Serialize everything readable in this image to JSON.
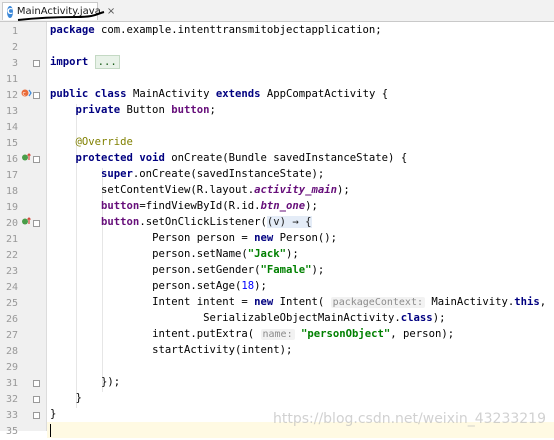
{
  "tab": {
    "icon": "class-file-icon",
    "icon_letter": "C",
    "title": "MainActivity.java",
    "close": "×"
  },
  "watermark": "https://blog.csdn.net/weixin_43233219",
  "colors": {
    "keyword": "#000080",
    "string": "#008000",
    "annotation": "#808000",
    "field": "#660e7a",
    "number": "#0000ff",
    "hint": "#8c8c8c",
    "current_line": "#fffae3"
  },
  "lines": [
    {
      "num": "1",
      "text": "package com.example.intenttransmitobjectapplication;"
    },
    {
      "num": "2",
      "text": ""
    },
    {
      "num": "3",
      "text": "import ..."
    },
    {
      "num": "11",
      "text": ""
    },
    {
      "num": "12",
      "text": "public class MainActivity extends AppCompatActivity {"
    },
    {
      "num": "13",
      "text": "    private Button button;"
    },
    {
      "num": "14",
      "text": ""
    },
    {
      "num": "15",
      "text": "    @Override"
    },
    {
      "num": "16",
      "text": "    protected void onCreate(Bundle savedInstanceState) {"
    },
    {
      "num": "17",
      "text": "        super.onCreate(savedInstanceState);"
    },
    {
      "num": "18",
      "text": "        setContentView(R.layout.activity_main);"
    },
    {
      "num": "19",
      "text": "        button=findViewById(R.id.btn_one);"
    },
    {
      "num": "20",
      "text": "        button.setOnClickListener((v) → {"
    },
    {
      "num": "21",
      "text": "                Person person = new Person();"
    },
    {
      "num": "22",
      "text": "                person.setName(\"Jack\");"
    },
    {
      "num": "23",
      "text": "                person.setGender(\"Famale\");"
    },
    {
      "num": "24",
      "text": "                person.setAge(18);"
    },
    {
      "num": "25",
      "text": "                Intent intent = new Intent( packageContext: MainActivity.this,"
    },
    {
      "num": "26",
      "text": "                        SerializableObjectMainActivity.class);"
    },
    {
      "num": "27",
      "text": "                intent.putExtra( name: \"personObject\", person);"
    },
    {
      "num": "28",
      "text": "                startActivity(intent);"
    },
    {
      "num": "29",
      "text": ""
    },
    {
      "num": "31",
      "text": "        });"
    },
    {
      "num": "32",
      "text": "    }"
    },
    {
      "num": "33",
      "text": "}"
    },
    {
      "num": "35",
      "text": ""
    }
  ],
  "tokens": {
    "package_kw": "package",
    "package_name": " com.example.intenttransmitobjectapplication;",
    "import_kw": "import",
    "import_fold": "...",
    "public": "public",
    "class": "class",
    "extends": "extends",
    "class_name": " MainActivity ",
    "super_name": " AppCompatActivity {",
    "private": "private",
    "button_type": " Button ",
    "button_field": "button",
    "semicolon": ";",
    "override": "@Override",
    "protected": "protected",
    "void": "void",
    "oncreate_sig": " onCreate(Bundle savedInstanceState) {",
    "super_kw": "super",
    "super_call": ".onCreate(savedInstanceState);",
    "setcontent_a": "setContentView(R.layout.",
    "layout_field": "activity_main",
    "close_paren_semi": ");",
    "findview_a": "=findViewById(R.id.",
    "btn_field": "btn_one",
    "setlistener": ".setOnClickListener(",
    "lambda": "(v) → {",
    "person_decl_a": "Person person = ",
    "new_kw": "new",
    "person_ctor": " Person();",
    "set_name_a": "person.setName(",
    "jack": "\"Jack\"",
    "set_gender_a": "person.setGender(",
    "famale": "\"Famale\"",
    "set_age_a": "person.setAge(",
    "age": "18",
    "intent_decl_a": "Intent intent = ",
    "intent_ctor": " Intent( ",
    "hint_package_context": "packageContext:",
    "main_activity": " MainActivity.",
    "this_kw": "this",
    "comma": ",",
    "serializable_class": "SerializableObjectMainActivity.",
    "class_kw": "class",
    "putextra_a": "intent.putExtra( ",
    "hint_name": "name:",
    "person_object": "\"personObject\"",
    "putextra_b": ", person);",
    "start_activity": "startActivity(intent);",
    "close_lambda": "});",
    "close_method": "}",
    "close_class": "}"
  },
  "gutter_marks": {
    "line12": "override-icon",
    "line16": "implement-icon",
    "line20": "implement-icon"
  },
  "line_number_readings": {
    "L1": "1",
    "L2": "2",
    "L3": "3",
    "L11": "11",
    "L12": "12",
    "L13": "13",
    "L14": "14",
    "L15": "15",
    "L16": "16",
    "L17": "17",
    "L18": "18",
    "L19": "19",
    "L20": "20",
    "L21": "21",
    "L22": "22",
    "L23": "23",
    "L24": "24",
    "L25": "25",
    "L26": "26",
    "L27": "27",
    "L28": "28",
    "L29": "29",
    "L31": "31",
    "L32": "32",
    "L33": "33",
    "L35": "35"
  }
}
